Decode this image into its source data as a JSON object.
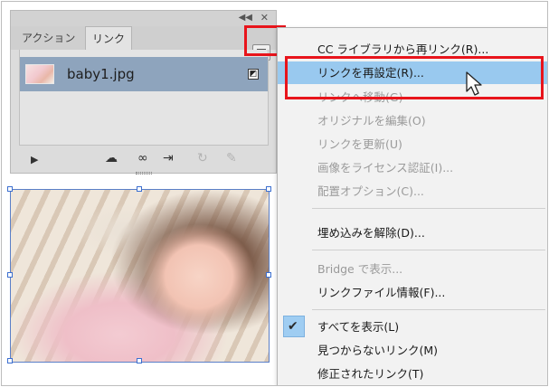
{
  "panel": {
    "tabs": [
      {
        "label": "アクション"
      },
      {
        "label": "リンク"
      }
    ],
    "collapse_icon": "double-chevron-right-icon",
    "close_icon": "close-icon",
    "menu_icon": "hamburger-menu-icon",
    "link_item": {
      "filename": "baby1.jpg",
      "status_icon": "link-status-icon"
    },
    "toolbar": {
      "play": "▶",
      "icons": [
        "cc-library-icon",
        "relink-icon",
        "go-to-link-icon",
        "update-link-icon",
        "edit-original-icon"
      ]
    }
  },
  "context_menu": {
    "items": [
      {
        "label": "CC ライブラリから再リンク(R)...",
        "enabled": true
      },
      {
        "label": "リンクを再設定(R)...",
        "enabled": true,
        "hovered": true
      },
      {
        "label": "リンクへ移動(G)",
        "enabled": false
      },
      {
        "label": "オリジナルを編集(O)",
        "enabled": false
      },
      {
        "label": "リンクを更新(U)",
        "enabled": false
      },
      {
        "label": "画像をライセンス認証(I)...",
        "enabled": false
      },
      {
        "label": "配置オプション(C)...",
        "enabled": false
      },
      {
        "label": "埋め込みを解除(D)...",
        "enabled": true
      },
      {
        "label": "Bridge で表示...",
        "enabled": false
      },
      {
        "label": "リンクファイル情報(F)...",
        "enabled": true
      },
      {
        "label": "すべてを表示(L)",
        "enabled": true,
        "checked": true
      },
      {
        "label": "見つからないリンク(M)",
        "enabled": true
      },
      {
        "label": "修正されたリンク(T)",
        "enabled": true
      }
    ]
  },
  "colors": {
    "highlight_red": "#e8141b",
    "hover_blue": "#99c9ef",
    "selected_row": "#8ea4bd",
    "selection_handles": "#3c6fd0"
  }
}
